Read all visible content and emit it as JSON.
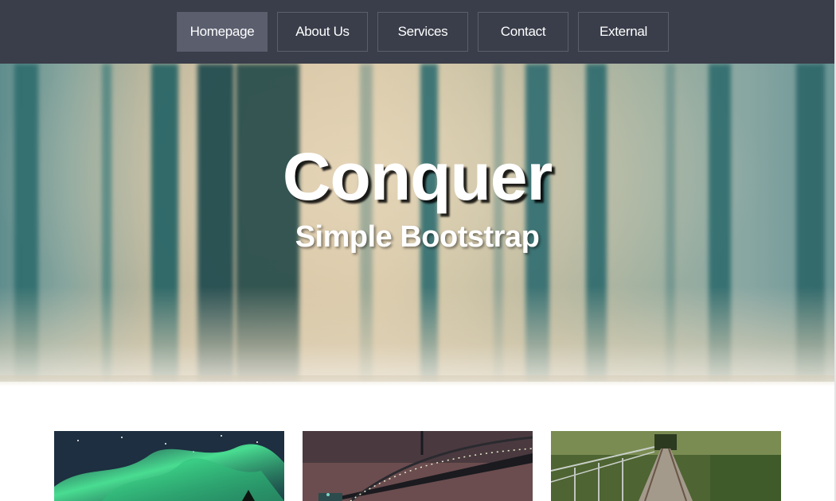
{
  "navbar": {
    "items": [
      {
        "label": "Homepage",
        "active": true
      },
      {
        "label": "About Us",
        "active": false
      },
      {
        "label": "Services",
        "active": false
      },
      {
        "label": "Contact",
        "active": false
      },
      {
        "label": "External",
        "active": false
      }
    ]
  },
  "hero": {
    "title": "Conquer",
    "subtitle": "Simple Bootstrap"
  },
  "gallery": {
    "items": [
      {
        "image": "aurora-night-sky-image"
      },
      {
        "image": "suspension-bridge-night-image"
      },
      {
        "image": "railway-track-forest-image"
      }
    ]
  },
  "colors": {
    "navbar_bg": "#3a3d4a",
    "nav_active_bg": "#5a5e6d",
    "nav_border": "#5b5f6c",
    "text": "#ffffff"
  }
}
